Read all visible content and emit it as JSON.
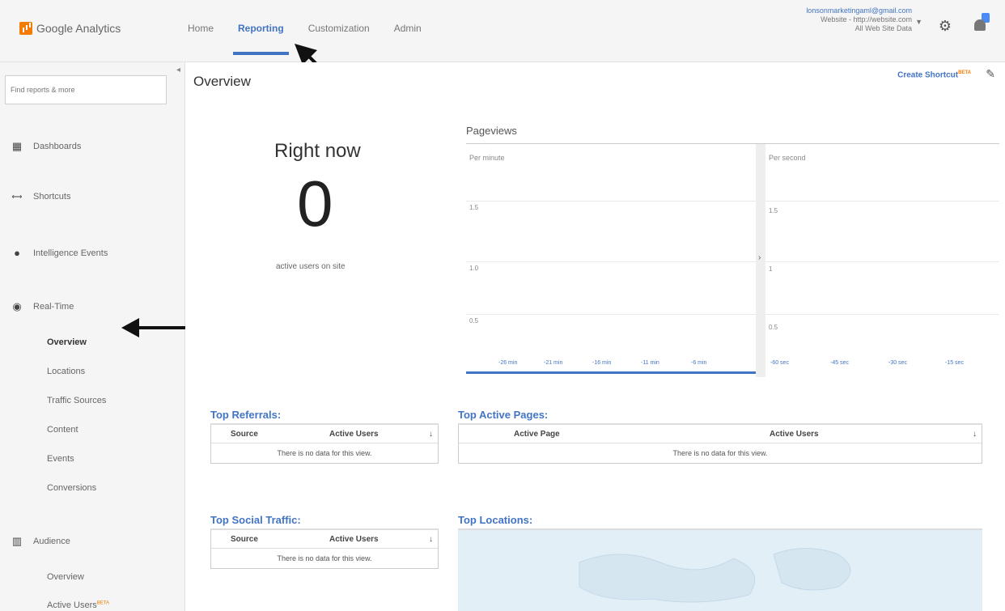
{
  "header": {
    "logo_text": "Google Analytics",
    "nav": [
      "Home",
      "Reporting",
      "Customization",
      "Admin"
    ],
    "account_email": "lonsonmarketingaml@gmail.com",
    "account_property": "Website - http://website.com",
    "account_view": "All Web Site Data"
  },
  "sidebar": {
    "search_placeholder": "Find reports & more",
    "sections": {
      "dashboards": "Dashboards",
      "shortcuts": "Shortcuts",
      "intelligence": "Intelligence Events",
      "realtime": "Real-Time",
      "audience": "Audience"
    },
    "realtime_items": [
      "Overview",
      "Locations",
      "Traffic Sources",
      "Content",
      "Events",
      "Conversions"
    ],
    "audience_items": [
      "Overview",
      "Active Users"
    ],
    "beta_tag": "BETA"
  },
  "main": {
    "title": "Overview",
    "create_shortcut": "Create Shortcut",
    "beta_tag": "BETA",
    "right_now": {
      "label": "Right now",
      "value": "0",
      "subtitle": "active users on site"
    },
    "pageviews": {
      "title": "Pageviews",
      "per_minute": "Per minute",
      "per_second": "Per second",
      "left_yticks": [
        "1.5",
        "1.0",
        "0.5"
      ],
      "right_yticks": [
        "1.5",
        "1",
        "0.5"
      ],
      "left_xticks": [
        "-26 min",
        "-21 min",
        "-16 min",
        "-11 min",
        "-6 min"
      ],
      "right_xticks": [
        "-60 sec",
        "-45 sec",
        "-30 sec",
        "-15 sec"
      ]
    },
    "top_referrals": {
      "title": "Top Referrals:",
      "col1": "Source",
      "col2": "Active Users",
      "empty": "There is no data for this view."
    },
    "top_active_pages": {
      "title": "Top Active Pages:",
      "col1": "Active Page",
      "col2": "Active Users",
      "empty": "There is no data for this view."
    },
    "top_social": {
      "title": "Top Social Traffic:",
      "col1": "Source",
      "col2": "Active Users",
      "empty": "There is no data for this view."
    },
    "top_locations": {
      "title": "Top Locations:"
    }
  }
}
